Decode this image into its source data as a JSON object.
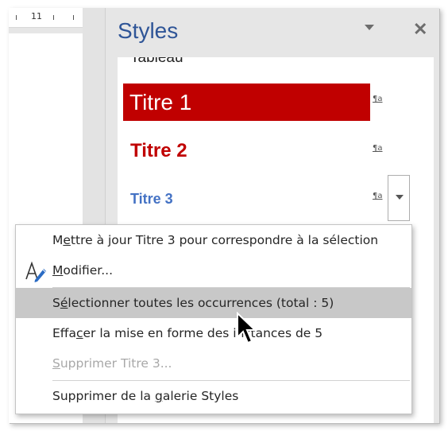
{
  "ruler": {
    "number": "11"
  },
  "pane": {
    "title": "Styles",
    "dropdown_icon": "chevron-down-icon",
    "close_icon": "close-icon",
    "close_glyph": "✕"
  },
  "styles": {
    "cut_item": "Tableau",
    "items": [
      {
        "label": "Titre 1",
        "mark": "¶a"
      },
      {
        "label": "Titre 2",
        "mark": "¶a"
      },
      {
        "label": "Titre 3",
        "mark": "¶a"
      }
    ]
  },
  "menu": {
    "update": {
      "pre": "M",
      "u": "e",
      "post": "ttre à jour Titre 3 pour correspondre à la sélection"
    },
    "modify": {
      "pre": "",
      "u": "M",
      "post": "odifier..."
    },
    "select_all": {
      "pre": "S",
      "u": "é",
      "post": "lectionner toutes les occurrences (total : 5)"
    },
    "clear": {
      "pre": "Effa",
      "u": "c",
      "post": "er la mise en forme des instances de 5"
    },
    "delete": {
      "pre": "",
      "u": "S",
      "post": "upprimer Titre 3..."
    },
    "remove_gallery": {
      "pre": "Supprimer de la ",
      "u": "g",
      "post": "alerie Styles"
    }
  },
  "colors": {
    "title_blue": "#2f5597",
    "heading_red": "#c00000",
    "heading3_blue": "#4472c4",
    "highlight_gray": "#c8c8c8"
  }
}
